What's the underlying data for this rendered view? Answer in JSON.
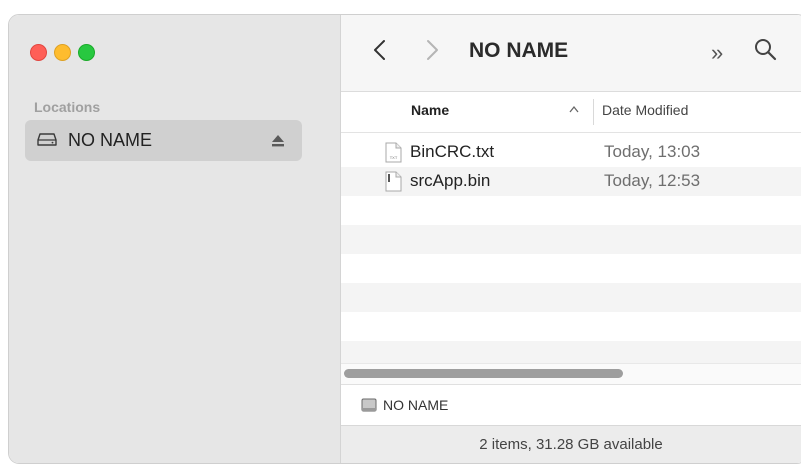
{
  "window": {
    "controls": [
      "close",
      "minimize",
      "zoom"
    ],
    "title": "NO NAME"
  },
  "sidebar": {
    "section_title": "Locations",
    "items": [
      {
        "label": "NO NAME",
        "icon": "external-drive-icon",
        "eject_icon": "eject-icon",
        "selected": true
      }
    ]
  },
  "toolbar": {
    "back_icon": "chevron-left-icon",
    "forward_icon": "chevron-right-icon",
    "more_icon": "»",
    "search_icon": "search-icon"
  },
  "columns": {
    "name": "Name",
    "date_modified": "Date Modified",
    "sort": "ascending"
  },
  "files": [
    {
      "name": "BinCRC.txt",
      "date": "Today, 13:03",
      "icon": "text-file-icon"
    },
    {
      "name": "srcApp.bin",
      "date": "Today, 12:53",
      "icon": "binary-file-icon"
    }
  ],
  "pathbar": {
    "label": "NO NAME"
  },
  "status": {
    "text": "2 items, 31.28 GB available"
  },
  "colors": {
    "sidebar_bg": "#e6e6e6",
    "selected_bg": "#d0d0d0",
    "close": "#ff5f57",
    "minimize": "#febc2e",
    "zoom": "#28c840",
    "alt_row": "#f4f4f4"
  }
}
